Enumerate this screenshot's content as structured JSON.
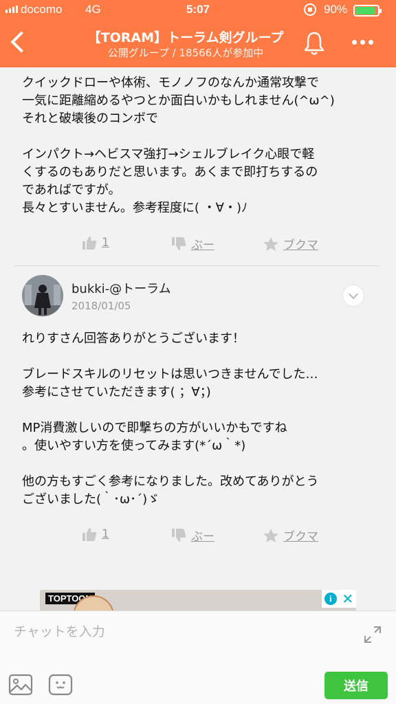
{
  "status_bar": {
    "carrier": "docomo",
    "network": "4G",
    "time": "5:07",
    "battery_percent": "90%",
    "battery_level": 0.9
  },
  "header": {
    "title": "【TORAM】トーラム剣グループ",
    "subtitle": "公開グループ / 18566人が参加中"
  },
  "post1": {
    "lines": [
      "クイックドローや体術、モノノフのなんか通常攻撃で",
      "一気に距離縮めるやつとか面白いかもしれません(^ω^)",
      "それと破壊後のコンボで",
      "",
      "インパクト→ヘビスマ強打→シェルブレイク心眼で軽",
      "くするのもありだと思います。あくまで即打ちするの",
      "であればですが。",
      "長々とすいません。参考程度に( ・∀・)ﾉ"
    ],
    "like_count": "1",
    "dislike_label": "ぶー",
    "bookmark_label": "ブクマ"
  },
  "post2": {
    "username": "bukki-@トーラム",
    "date": "2018/01/05",
    "lines": [
      "れりすさん回答ありがとうございます！",
      "",
      "ブレードスキルのリセットは思いつきませんでした…",
      "参考にさせていただきます( ；∀；)",
      "",
      "MP消費激しいので即撃ちの方がいいかもですね",
      "。使いやすい方を使ってみます(*´ω｀*)",
      "",
      "他の方もすごく参考になりました。改めてありがとう",
      "ございました(｀･ω･´)ゞ"
    ],
    "like_count": "1",
    "dislike_label": "ぶー",
    "bookmark_label": "ブクマ"
  },
  "ad": {
    "brand": "TOPTOON"
  },
  "composer": {
    "placeholder": "チャットを入力",
    "send_label": "送信"
  },
  "colors": {
    "header": "#ff7a44",
    "send": "#3fc43f",
    "action": "#9a9a9a"
  }
}
